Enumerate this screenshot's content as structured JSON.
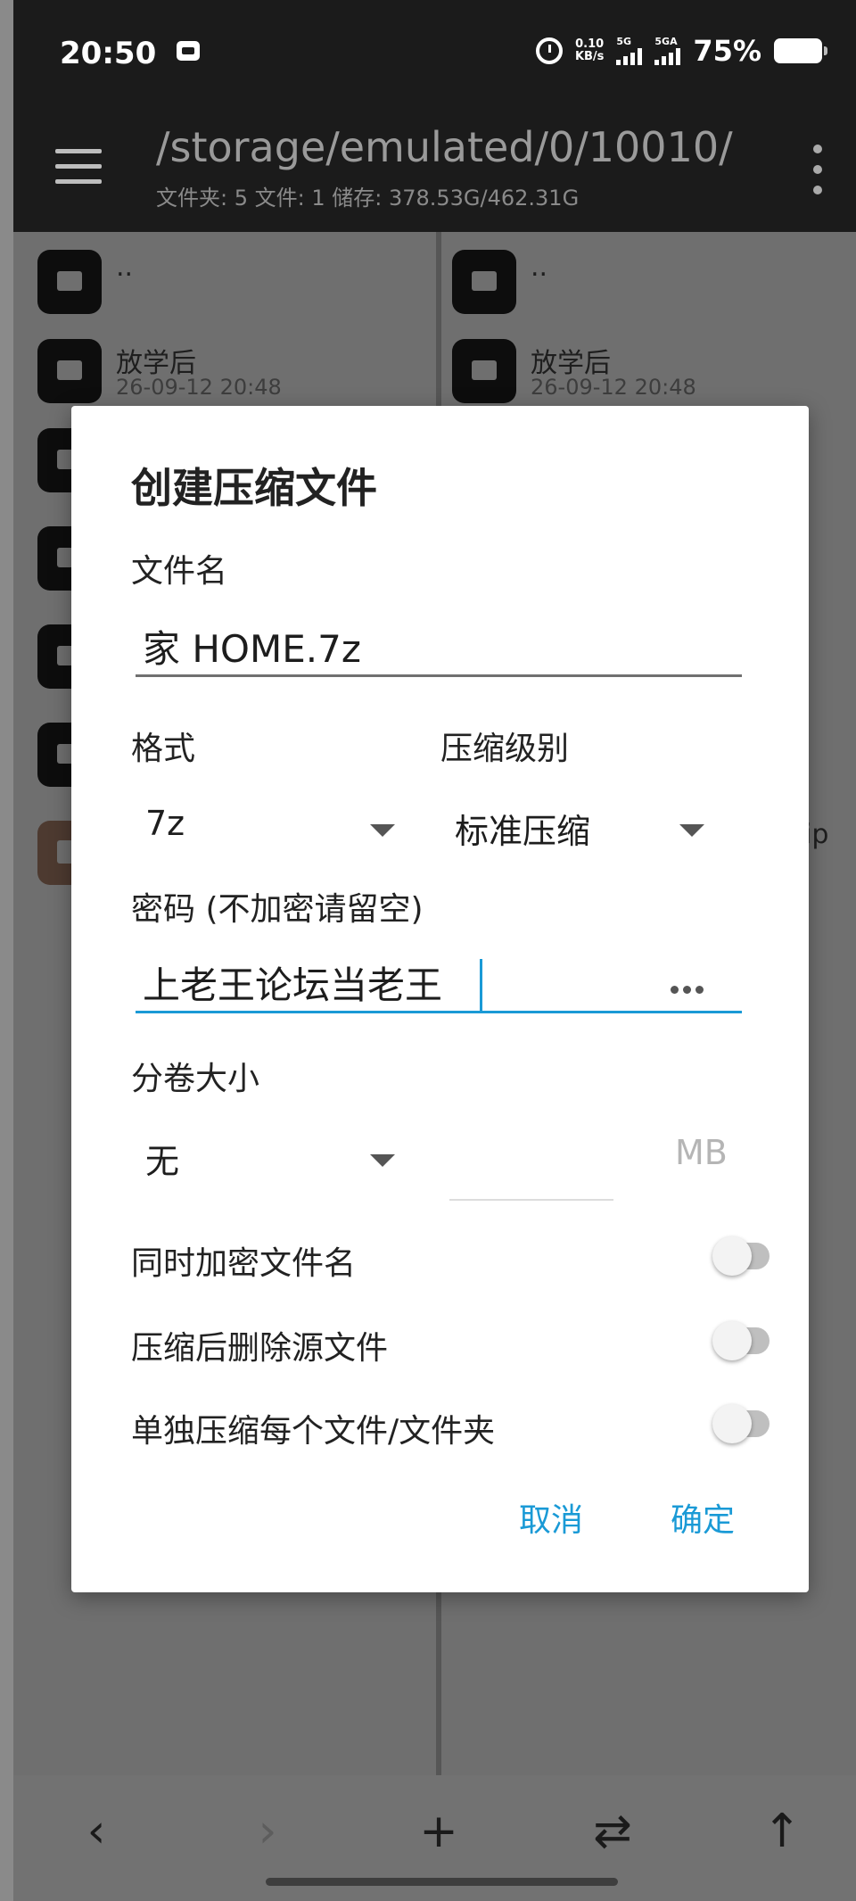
{
  "status_bar": {
    "time": "20:50",
    "net_speed_value": "0.10",
    "net_speed_unit": "KB/s",
    "sim1_label": "5G",
    "sim2_label": "5GA",
    "battery_percent": "75%"
  },
  "toolbar": {
    "path": "/storage/emulated/0/10010/",
    "info": "文件夹: 5  文件: 1  储存: 378.53G/462.31G"
  },
  "left_pane": {
    "items": [
      {
        "name": "..",
        "date": ""
      },
      {
        "name": "放学后",
        "date": "26-09-12 20:48"
      }
    ]
  },
  "right_pane": {
    "items": [
      {
        "name": "..",
        "date": ""
      },
      {
        "name": "放学后",
        "date": "26-09-12 20:48"
      }
    ],
    "zip_fragment": "ip"
  },
  "dialog": {
    "title": "创建压缩文件",
    "filename_label": "文件名",
    "filename_value": "家 HOME.7z",
    "format_label": "格式",
    "format_value": "7z",
    "level_label": "压缩级别",
    "level_value": "标准压缩",
    "password_label": "密码 (不加密请留空)",
    "password_value": "上老王论坛当老王",
    "split_label": "分卷大小",
    "split_value": "无",
    "split_unit": "MB",
    "toggles": [
      {
        "label": "同时加密文件名",
        "on": false
      },
      {
        "label": "压缩后删除源文件",
        "on": false
      },
      {
        "label": "单独压缩每个文件/文件夹",
        "on": false
      }
    ],
    "cancel_label": "取消",
    "ok_label": "确定"
  },
  "bottom_nav": {
    "back": "‹",
    "forward": "›",
    "add": "+",
    "swap": "⇄",
    "up": "↑"
  },
  "colors": {
    "accent": "#1a9ad6",
    "toolbar_bg": "#1b1b1b",
    "scrim": "#6d6d6d"
  }
}
